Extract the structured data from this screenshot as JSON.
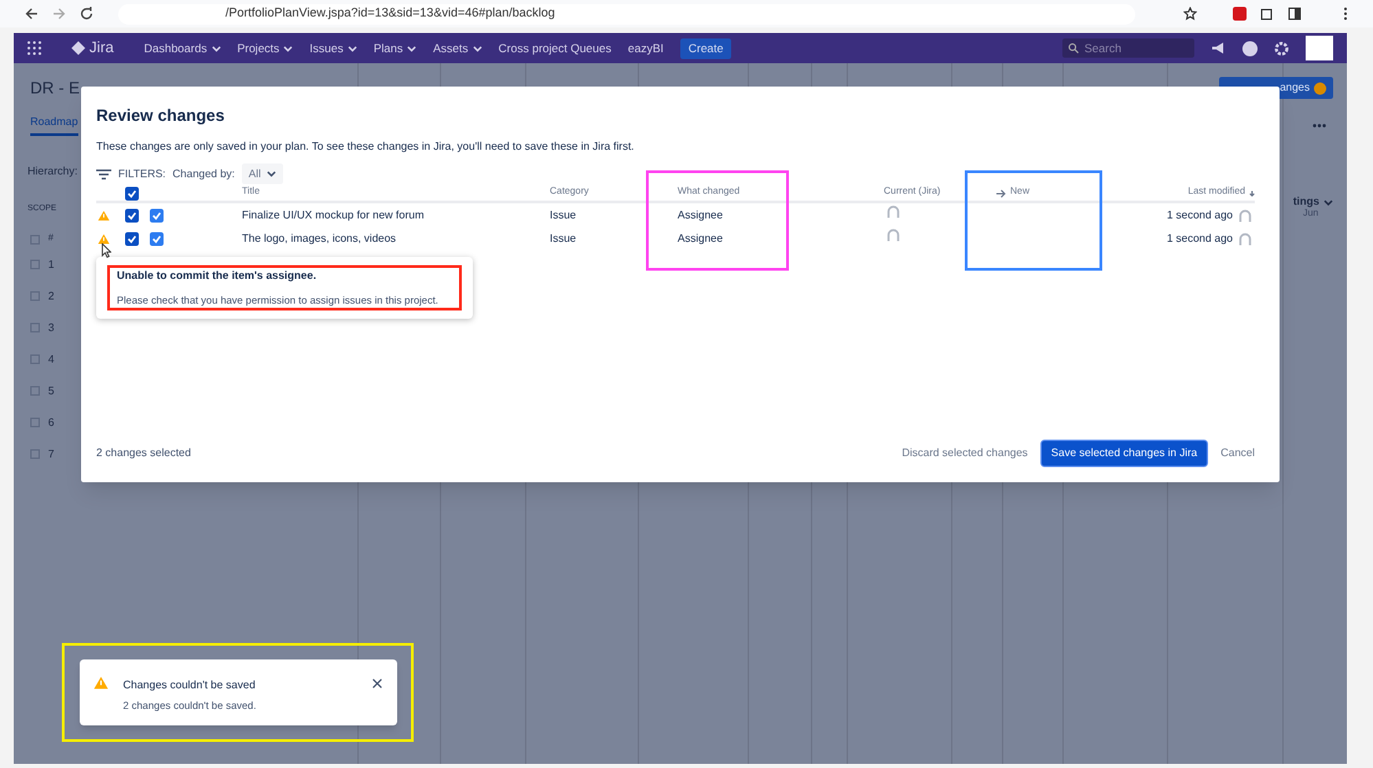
{
  "browser": {
    "url": "/PortfolioPlanView.jspa?id=13&sid=13&vid=46#plan/backlog"
  },
  "nav": {
    "product": "Jira",
    "items": [
      {
        "label": "Dashboards",
        "dropdown": true
      },
      {
        "label": "Projects",
        "dropdown": true
      },
      {
        "label": "Issues",
        "dropdown": true
      },
      {
        "label": "Plans",
        "dropdown": true
      },
      {
        "label": "Assets",
        "dropdown": true
      },
      {
        "label": "Cross project Queues",
        "dropdown": false
      },
      {
        "label": "eazyBI",
        "dropdown": false
      }
    ],
    "create": "Create",
    "search_placeholder": "Search"
  },
  "page": {
    "title": "DR - E",
    "tab": "Roadmap",
    "hierarchy_label": "Hierarchy:",
    "scope_header": "SCOPE",
    "number_header": "#",
    "rows": [
      {
        "number": "1",
        "checked": false
      },
      {
        "number": "2",
        "checked": false
      },
      {
        "number": "3",
        "checked": false
      },
      {
        "number": "4",
        "checked": false
      },
      {
        "number": "5",
        "checked": false
      },
      {
        "number": "6",
        "checked": false
      },
      {
        "number": "7",
        "checked": false
      }
    ],
    "settings": "tings",
    "month": "Jun",
    "review_button": "anges"
  },
  "dialog": {
    "title": "Review changes",
    "subtitle": "These changes are only saved in your plan. To see these changes in Jira, you'll need to save these in Jira first.",
    "filters_label": "FILTERS:",
    "changed_by_label": "Changed by:",
    "changed_by_value": "All",
    "select_all_checked": true,
    "columns": [
      {
        "label": "Title"
      },
      {
        "label": "Category"
      },
      {
        "label": "What changed",
        "color": "#ff44f0"
      },
      {
        "label": "Current (Jira)"
      },
      {
        "label": "New",
        "color": "#3a86ff"
      },
      {
        "label": "Last modified"
      }
    ],
    "rows": [
      {
        "warning": true,
        "checked": true,
        "item_checked": true,
        "title": "Finalize UI/UX mockup for new forum",
        "category": "Issue",
        "what_changed": "Assignee",
        "last_modified": "1 second ago"
      },
      {
        "warning": true,
        "checked": true,
        "item_checked": true,
        "title": "The logo, images, icons, videos",
        "category": "Issue",
        "what_changed": "Assignee",
        "last_modified": "1 second ago"
      }
    ],
    "tooltip": {
      "title": "Unable to commit the item's assignee.",
      "message": "Please check that you have permission to assign issues in this project.",
      "color": "#ff2a1a"
    },
    "selected_count": "2 changes selected",
    "discard": "Discard selected changes",
    "save": "Save selected changes in Jira",
    "cancel": "Cancel"
  },
  "toast": {
    "title": "Changes couldn't be saved",
    "message": "2 changes couldn't be saved.",
    "color": "#f5ee00"
  }
}
